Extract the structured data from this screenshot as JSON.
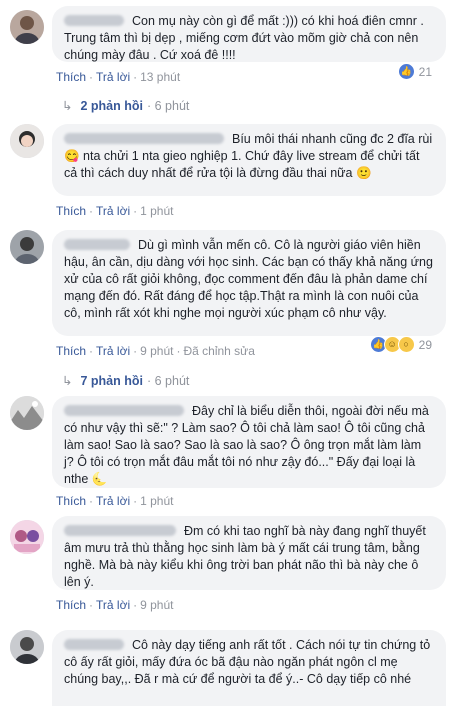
{
  "actions": {
    "like": "Thích",
    "reply": "Trả lời",
    "edited": "Đã chỉnh sửa"
  },
  "comments": [
    {
      "text": "Con mụ này còn gì để mất :))) có khi hoá điên cmnr . Trung tâm thì bị dẹp , miếng cơm đứt vào mõm giờ chả con nên chúng mày đâu . Cứ xoá đê !!!!",
      "time": "13 phút",
      "reactions": {
        "types": [
          "like-icon"
        ],
        "count": "21"
      },
      "replies": {
        "label": "2 phản hồi",
        "time": "6 phút"
      }
    },
    {
      "text": "Bíu môi thái nhanh cũng đc 2 đĩa rùi 😋 nta chửi 1 nta gieo nghiệp 1. Chứ đây live stream để chửi tất cả thì cách duy nhất để rửa tội là đừng đầu thai nữa 🙂",
      "time": "1 phút"
    },
    {
      "text": "Dù gì mình vẫn mến cô. Cô là người giáo viên hiền hậu, ân cần, dịu dàng với học sinh. Các bạn có thấy khả năng ứng xử của cô rất giỏi không, đọc comment đến đâu là phản dame chí mạng đến đó. Rất đáng để học tập.Thật ra mình là con nuôi của cô, mình rất xót khi nghe mọi người xúc phạm cô như vậy.",
      "time": "9 phút",
      "reactions": {
        "types": [
          "like-icon",
          "haha-icon",
          "wow-icon"
        ],
        "count": "29"
      },
      "replies": {
        "label": "7 phản hồi",
        "time": "6 phút"
      }
    },
    {
      "text": "Đây chỉ là biểu diễn thôi, ngoài đời nếu mà có như vậy thì sẽ:\" ? Làm sao? Ô tôi chả làm sao! Ô tôi cũng chả làm sao! Sao là sao? Sao là sao là sao? Ô ông trọn mắt làm làm j? Ô tôi có trọn mắt đâu mắt tôi nó như zậy đó...\" Đấy đại loại là nthe 🌜",
      "time": "1 phút"
    },
    {
      "text": "Đm có khi tao nghĩ bà này đang nghĩ thuyết âm mưu trả thù thằng học sinh làm bà ý mất cái trung tâm, bằng nghề. Mà bà này kiểu khi ông trời ban phát não thì bà này che ô lên ý.",
      "time": "9 phút"
    },
    {
      "text": "Cô này dạy tiếng anh rất tốt . Cách nói tự tin chứng tỏ cô ấy rất giỏi, mấy đứa óc bã đậu nào ngăn phát ngôn cl mẹ chúng bay,,. Đã r mà cứ để người ta để ý..- Cô dạy tiếp cô nhé"
    }
  ]
}
